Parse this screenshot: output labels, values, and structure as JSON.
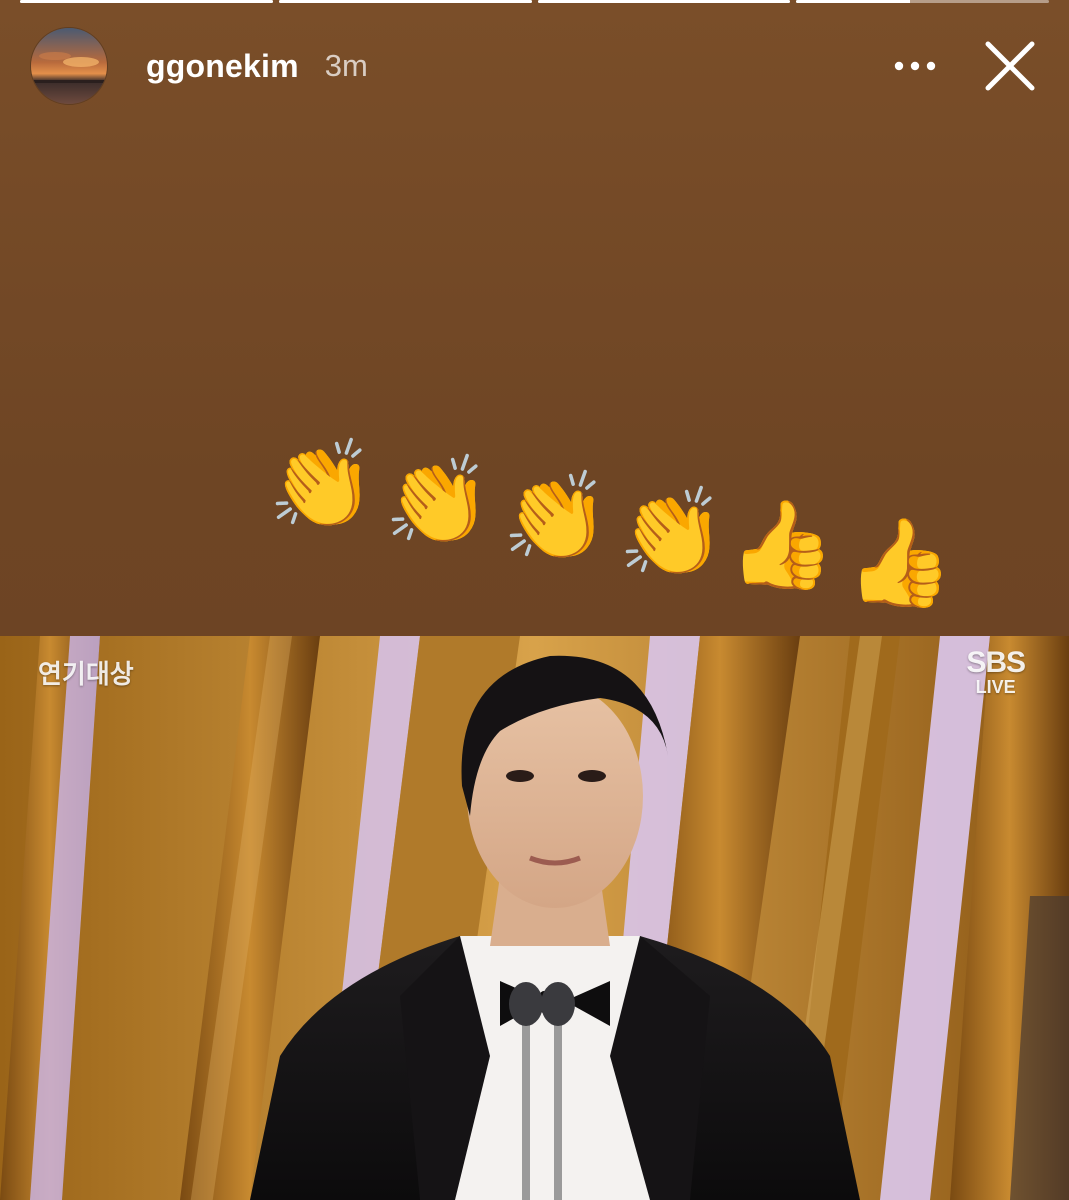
{
  "story": {
    "progress": [
      1,
      1,
      1,
      0.45
    ],
    "username": "ggonekim",
    "timestamp": "3m",
    "more_icon": "more-horizontal-icon",
    "close_icon": "close-icon",
    "background_color": "#6e4524"
  },
  "emojis": [
    "👏",
    "👏",
    "👏",
    "👏",
    "👍",
    "👍"
  ],
  "photo": {
    "show_logo": "연기대상",
    "network": "SBS",
    "live": "LIVE"
  }
}
